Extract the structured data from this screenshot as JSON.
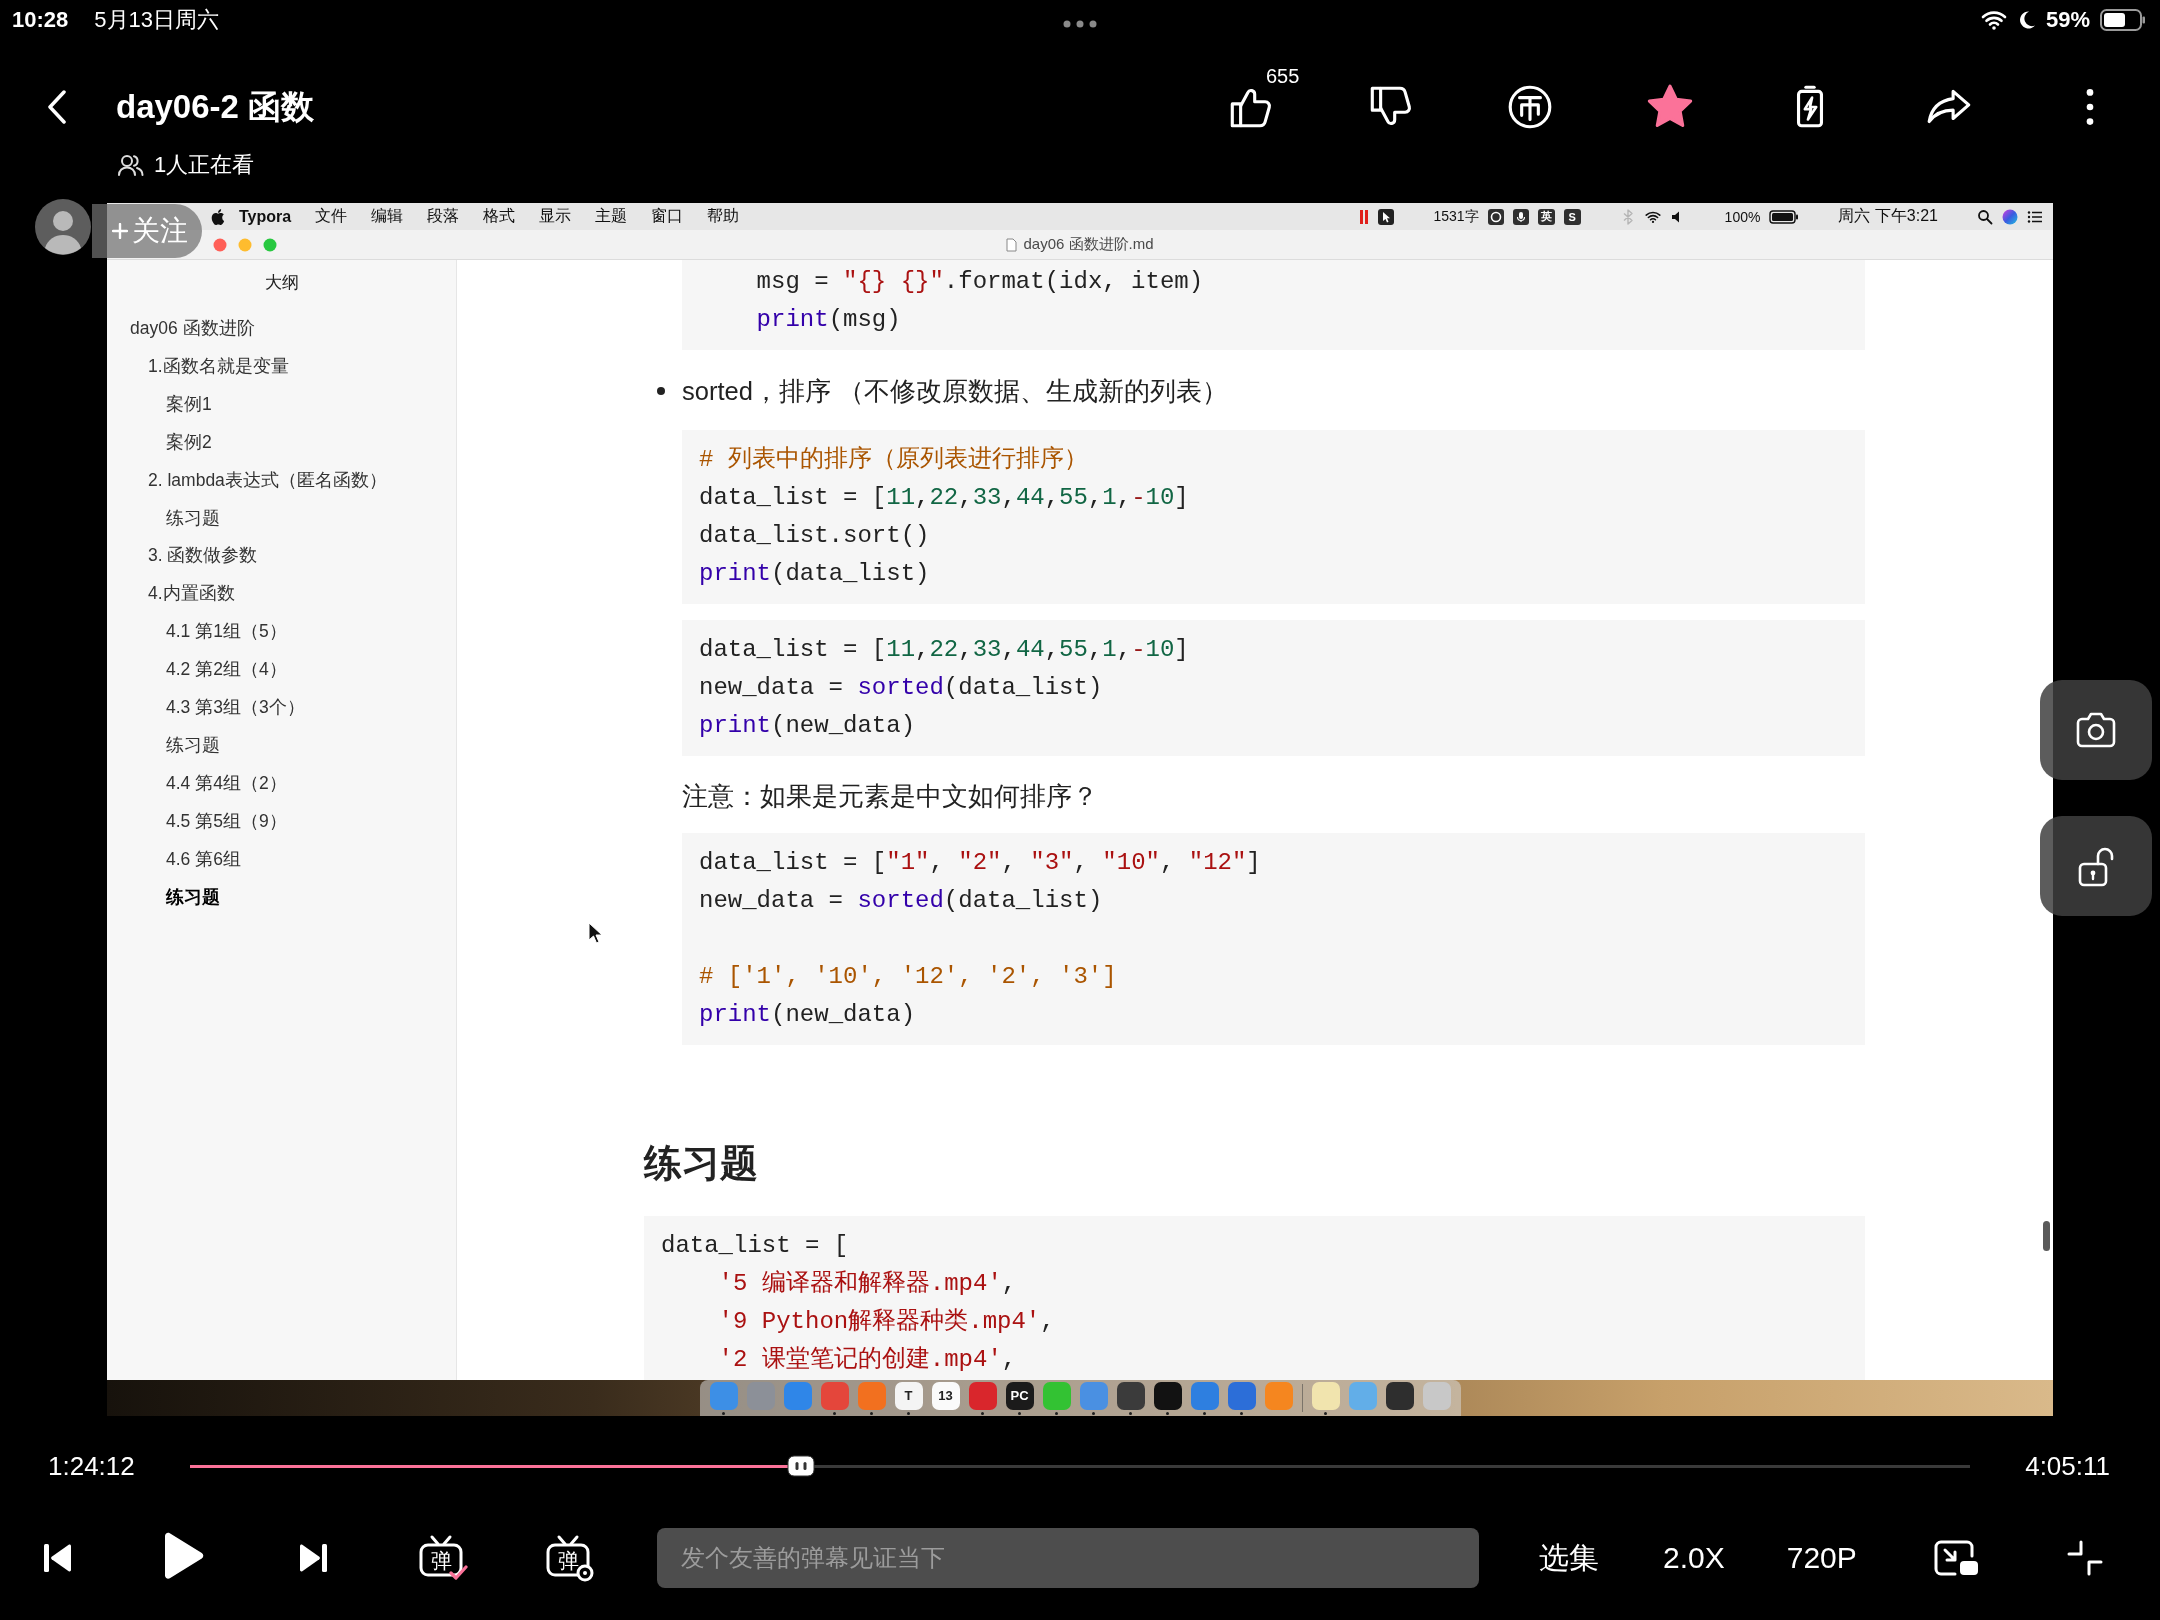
{
  "status_bar": {
    "time": "10:28",
    "date": "5月13日周六",
    "battery": "59%"
  },
  "header": {
    "title": "day06-2 函数",
    "viewers": "1人正在看",
    "actions": [
      {
        "kind": "like",
        "count": "655",
        "on": false
      },
      {
        "kind": "dislike",
        "on": false
      },
      {
        "kind": "coin",
        "on": false
      },
      {
        "kind": "favorite",
        "on": true
      },
      {
        "kind": "charge",
        "on": false
      },
      {
        "kind": "share",
        "on": false
      },
      {
        "kind": "more",
        "on": false
      }
    ]
  },
  "uploader": {
    "follow_label": "关注"
  },
  "video": {
    "menu_bar": {
      "app": "Typora",
      "menus": [
        "文件",
        "编辑",
        "段落",
        "格式",
        "显示",
        "主题",
        "窗口",
        "帮助"
      ],
      "word_count": "1531字",
      "input_method": "英",
      "tray_glyph": "S",
      "battery": "100%",
      "clock": "周六 下午3:21"
    },
    "window": {
      "file_name": "day06 函数进阶.md"
    },
    "outline": {
      "title": "大纲",
      "items": [
        {
          "label": "day06 函数进阶",
          "selected": false,
          "children": [
            {
              "label": "1.函数名就是变量",
              "selected": false,
              "children": [
                {
                  "label": "案例1",
                  "selected": false
                },
                {
                  "label": "案例2",
                  "selected": false
                }
              ]
            },
            {
              "label": "2. lambda表达式（匿名函数）",
              "selected": false,
              "children": [
                {
                  "label": "练习题",
                  "selected": false
                }
              ]
            },
            {
              "label": "3. 函数做参数",
              "selected": false
            },
            {
              "label": "4.内置函数",
              "selected": false,
              "children": [
                {
                  "label": "4.1 第1组（5）",
                  "selected": false
                },
                {
                  "label": "4.2 第2组（4）",
                  "selected": false
                },
                {
                  "label": "4.3 第3组（3个）",
                  "selected": false
                },
                {
                  "label": "练习题",
                  "selected": false
                },
                {
                  "label": "4.4 第4组（2）",
                  "selected": false
                },
                {
                  "label": "4.5 第5组（9）",
                  "selected": false
                },
                {
                  "label": "4.6 第6组",
                  "selected": false
                },
                {
                  "label": "练习题",
                  "selected": true
                }
              ]
            }
          ]
        }
      ]
    },
    "document": [
      {
        "kind": "list",
        "items": [
          {
            "blocks": [
              {
                "kind": "code",
                "groups": [
                  [
                    [
                      {
                        "kind": "plain",
                        "text": "    msg = "
                      },
                      {
                        "kind": "string",
                        "text": "\"{} {}\""
                      },
                      {
                        "kind": "plain",
                        "text": ".format(idx, item)"
                      }
                    ],
                    [
                      {
                        "kind": "builtin",
                        "text": "    print"
                      },
                      {
                        "kind": "plain",
                        "text": "(msg)"
                      }
                    ]
                  ]
                ]
              }
            ]
          },
          {
            "text": "sorted，排序 （不修改原数据、生成新的列表）",
            "blocks": [
              {
                "kind": "code",
                "groups": [
                  [
                    [
                      {
                        "kind": "comment",
                        "text": "# 列表中的排序（原列表进行排序）"
                      }
                    ],
                    [
                      {
                        "kind": "plain",
                        "text": "data_list = ["
                      },
                      {
                        "kind": "number",
                        "text": "11"
                      },
                      {
                        "kind": "plain",
                        "text": ","
                      },
                      {
                        "kind": "number",
                        "text": "22"
                      },
                      {
                        "kind": "plain",
                        "text": ","
                      },
                      {
                        "kind": "number",
                        "text": "33"
                      },
                      {
                        "kind": "plain",
                        "text": ","
                      },
                      {
                        "kind": "number",
                        "text": "44"
                      },
                      {
                        "kind": "plain",
                        "text": ","
                      },
                      {
                        "kind": "number",
                        "text": "55"
                      },
                      {
                        "kind": "plain",
                        "text": ","
                      },
                      {
                        "kind": "number",
                        "text": "1"
                      },
                      {
                        "kind": "plain",
                        "text": ","
                      },
                      {
                        "kind": "operator",
                        "text": "-"
                      },
                      {
                        "kind": "number",
                        "text": "10"
                      },
                      {
                        "kind": "plain",
                        "text": "]"
                      }
                    ],
                    [
                      {
                        "kind": "plain",
                        "text": "data_list.sort()"
                      }
                    ],
                    [
                      {
                        "kind": "builtin",
                        "text": "print"
                      },
                      {
                        "kind": "plain",
                        "text": "(data_list)"
                      }
                    ]
                  ]
                ]
              },
              {
                "kind": "code",
                "groups": [
                  [
                    [
                      {
                        "kind": "plain",
                        "text": "data_list = ["
                      },
                      {
                        "kind": "number",
                        "text": "11"
                      },
                      {
                        "kind": "plain",
                        "text": ","
                      },
                      {
                        "kind": "number",
                        "text": "22"
                      },
                      {
                        "kind": "plain",
                        "text": ","
                      },
                      {
                        "kind": "number",
                        "text": "33"
                      },
                      {
                        "kind": "plain",
                        "text": ","
                      },
                      {
                        "kind": "number",
                        "text": "44"
                      },
                      {
                        "kind": "plain",
                        "text": ","
                      },
                      {
                        "kind": "number",
                        "text": "55"
                      },
                      {
                        "kind": "plain",
                        "text": ","
                      },
                      {
                        "kind": "number",
                        "text": "1"
                      },
                      {
                        "kind": "plain",
                        "text": ","
                      },
                      {
                        "kind": "operator",
                        "text": "-"
                      },
                      {
                        "kind": "number",
                        "text": "10"
                      },
                      {
                        "kind": "plain",
                        "text": "]"
                      }
                    ],
                    [
                      {
                        "kind": "plain",
                        "text": "new_data = "
                      },
                      {
                        "kind": "builtin",
                        "text": "sorted"
                      },
                      {
                        "kind": "plain",
                        "text": "(data_list)"
                      }
                    ],
                    [
                      {
                        "kind": "builtin",
                        "text": "print"
                      },
                      {
                        "kind": "plain",
                        "text": "(new_data)"
                      }
                    ]
                  ]
                ]
              },
              {
                "kind": "paragraph",
                "text": "注意：如果是元素是中文如何排序？"
              },
              {
                "kind": "code",
                "groups": [
                  [
                    [
                      {
                        "kind": "plain",
                        "text": "data_list = ["
                      },
                      {
                        "kind": "string",
                        "text": "\"1\""
                      },
                      {
                        "kind": "plain",
                        "text": ", "
                      },
                      {
                        "kind": "string",
                        "text": "\"2\""
                      },
                      {
                        "kind": "plain",
                        "text": ", "
                      },
                      {
                        "kind": "string",
                        "text": "\"3\""
                      },
                      {
                        "kind": "plain",
                        "text": ", "
                      },
                      {
                        "kind": "string",
                        "text": "\"10\""
                      },
                      {
                        "kind": "plain",
                        "text": ", "
                      },
                      {
                        "kind": "string",
                        "text": "\"12\""
                      },
                      {
                        "kind": "plain",
                        "text": "]"
                      }
                    ],
                    [
                      {
                        "kind": "plain",
                        "text": "new_data = "
                      },
                      {
                        "kind": "builtin",
                        "text": "sorted"
                      },
                      {
                        "kind": "plain",
                        "text": "(data_list)"
                      }
                    ]
                  ],
                  [
                    [
                      {
                        "kind": "comment",
                        "text": "# ['1', '10', '12', '2', '3']"
                      }
                    ],
                    [
                      {
                        "kind": "builtin",
                        "text": "print"
                      },
                      {
                        "kind": "plain",
                        "text": "(new_data)"
                      }
                    ]
                  ]
                ]
              }
            ]
          }
        ]
      },
      {
        "kind": "heading",
        "text": "练习题"
      },
      {
        "kind": "code",
        "groups": [
          [
            [
              {
                "kind": "plain",
                "text": "data_list = ["
              }
            ],
            [
              {
                "kind": "string",
                "text": "    '5 编译器和解释器.mp4'"
              },
              {
                "kind": "plain",
                "text": ","
              }
            ],
            [
              {
                "kind": "string",
                "text": "    '9 Python解释器种类.mp4'"
              },
              {
                "kind": "plain",
                "text": ","
              }
            ],
            [
              {
                "kind": "string",
                "text": "    '2 课堂笔记的创建.mp4'"
              },
              {
                "kind": "plain",
                "text": ","
              }
            ]
          ]
        ]
      }
    ],
    "dock": [
      {
        "kind": "app",
        "color": "#3d8fe6",
        "running": true
      },
      {
        "kind": "app",
        "color": "#8c9098",
        "running": false
      },
      {
        "kind": "app",
        "color": "#2f86e8",
        "running": false
      },
      {
        "kind": "app",
        "color": "#e4463b",
        "running": true
      },
      {
        "kind": "app",
        "color": "#f2701f",
        "running": true
      },
      {
        "kind": "app",
        "color": "#f4f4f4",
        "glyph": "T",
        "running": true
      },
      {
        "kind": "app",
        "color": "#fafafa",
        "glyph": "13",
        "running": false
      },
      {
        "kind": "app",
        "color": "#d9262c",
        "running": true
      },
      {
        "kind": "app",
        "color": "#1b1b1b",
        "glyph": "PC",
        "running": true
      },
      {
        "kind": "app",
        "color": "#33c233",
        "running": true
      },
      {
        "kind": "app",
        "color": "#4a90e2",
        "running": true
      },
      {
        "kind": "app",
        "color": "#3b3b3b",
        "running": true
      },
      {
        "kind": "app",
        "color": "#121212",
        "running": true
      },
      {
        "kind": "app",
        "color": "#2e7fe0",
        "running": true
      },
      {
        "kind": "app",
        "color": "#2c6ed8",
        "running": true
      },
      {
        "kind": "app",
        "color": "#f5861f",
        "running": false
      },
      {
        "kind": "divider"
      },
      {
        "kind": "app",
        "color": "#f1e4ae",
        "running": true
      },
      {
        "kind": "app",
        "color": "#62aee8",
        "running": false
      },
      {
        "kind": "app",
        "color": "#2e2e2e",
        "running": false
      },
      {
        "kind": "app",
        "color": "#c8c8c8",
        "running": false
      }
    ]
  },
  "player": {
    "elapsed": "1:24:12",
    "duration": "4:05:11",
    "progress": {
      "level": 0.343
    },
    "danmaku_toggle": {
      "glyph": "弹",
      "on": true
    },
    "danmaku_settings": {
      "glyph": "弹"
    },
    "danmaku_input": {
      "placeholder": "发个友善的弹幕见证当下"
    },
    "episodes": "选集",
    "speed": "2.0X",
    "quality": "720P"
  }
}
